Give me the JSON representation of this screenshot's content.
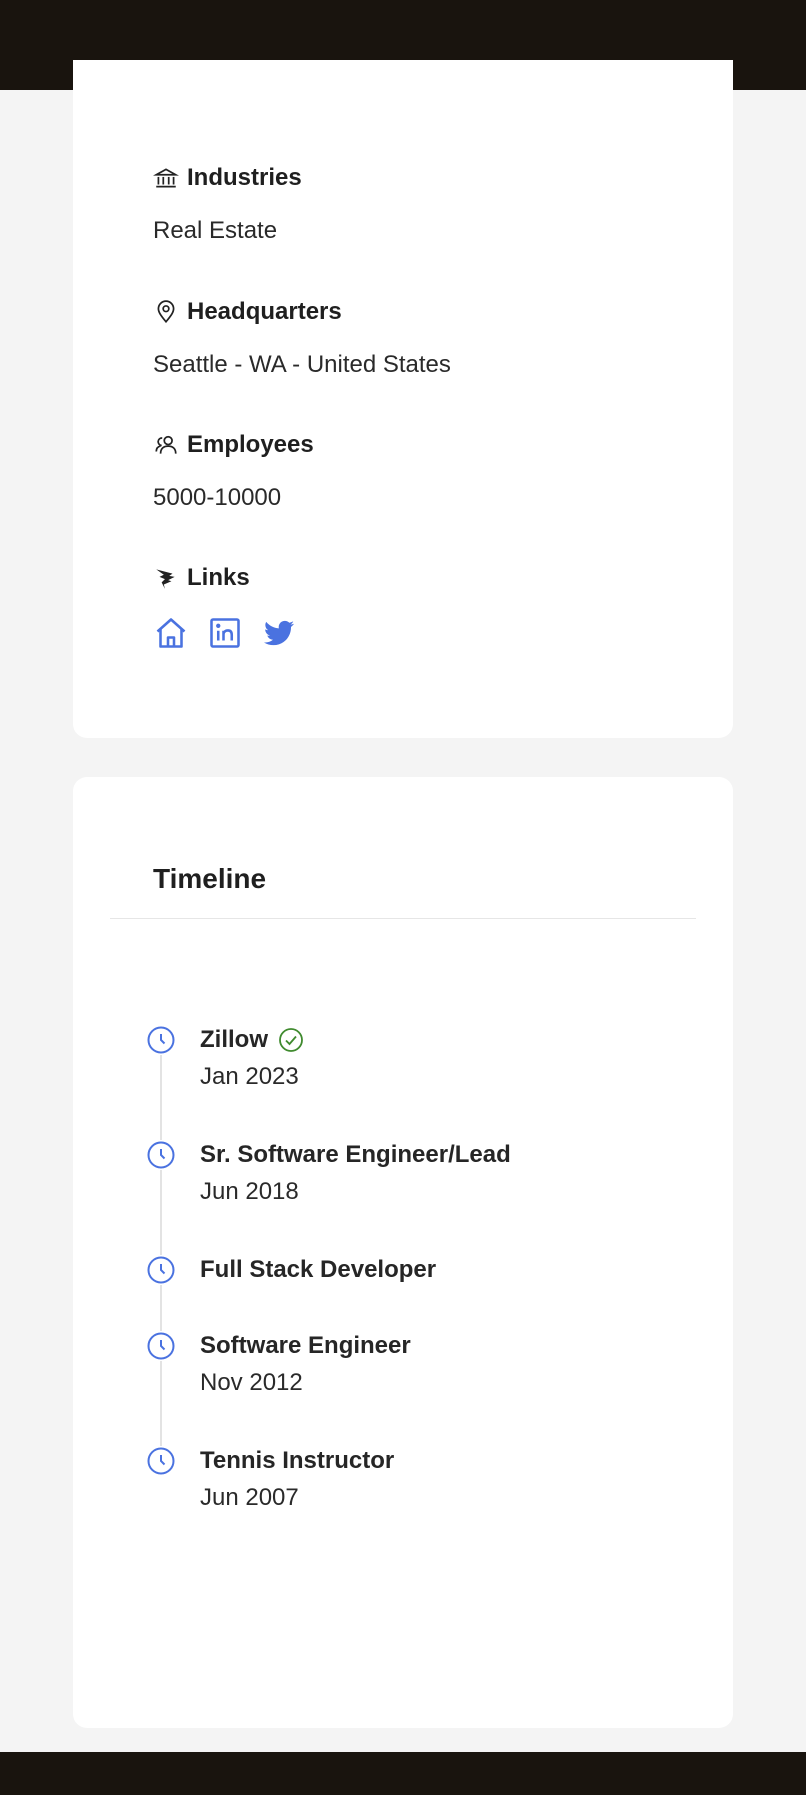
{
  "info": {
    "industries": {
      "label": "Industries",
      "value": "Real Estate",
      "icon": "bank-icon"
    },
    "headquarters": {
      "label": "Headquarters",
      "value": "Seattle - WA - United States",
      "icon": "map-pin-icon"
    },
    "employees": {
      "label": "Employees",
      "value": "5000-10000",
      "icon": "users-icon"
    },
    "links": {
      "label": "Links",
      "icon": "link-wing-icon",
      "items": [
        {
          "name": "home-link-icon"
        },
        {
          "name": "linkedin-link-icon"
        },
        {
          "name": "twitter-link-icon"
        }
      ]
    }
  },
  "timeline": {
    "title": "Timeline",
    "items": [
      {
        "title": "Zillow",
        "date": "Jan 2023",
        "verified": true
      },
      {
        "title": "Sr. Software Engineer/Lead",
        "date": "Jun 2018",
        "verified": false
      },
      {
        "title": "Full Stack Developer",
        "date": "",
        "verified": false
      },
      {
        "title": "Software Engineer",
        "date": "Nov 2012",
        "verified": false
      },
      {
        "title": "Tennis Instructor",
        "date": "Jun 2007",
        "verified": false
      }
    ]
  },
  "colors": {
    "accent": "#4a72e0",
    "verified": "#3f8a2e",
    "bar": "#19140e",
    "background": "#f4f4f4"
  }
}
